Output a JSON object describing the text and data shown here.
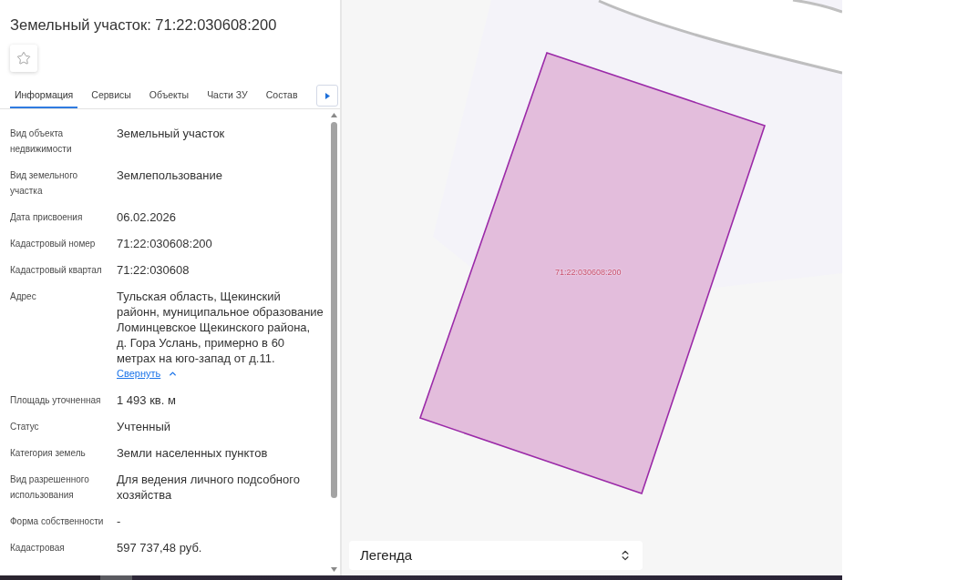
{
  "header": {
    "title": "Земельный участок: 71:22:030608:200"
  },
  "favorite": {
    "active": false
  },
  "tabs": [
    {
      "label": "Информация",
      "selected": true
    },
    {
      "label": "Сервисы",
      "selected": false
    },
    {
      "label": "Объекты",
      "selected": false
    },
    {
      "label": "Части ЗУ",
      "selected": false
    },
    {
      "label": "Состав",
      "selected": false
    }
  ],
  "fields": [
    {
      "kind": "text",
      "label": "Вид объекта недвижимости",
      "value": "Земельный участок"
    },
    {
      "kind": "text",
      "label": "Вид земельного участка",
      "value": "Землепользование"
    },
    {
      "kind": "text",
      "label": "Дата присвоения",
      "value": "06.02.2026"
    },
    {
      "kind": "text",
      "label": "Кадастровый номер",
      "value": "71:22:030608:200"
    },
    {
      "kind": "text",
      "label": "Кадастровый квартал",
      "value": "71:22:030608"
    },
    {
      "kind": "lines",
      "label": "Адрес",
      "value_lines": [
        "Тульская область, Щекинский",
        "районн, муниципальное образование",
        "Ломинцевское Щекинского района,",
        "д. Гора Услань, примерно в 60",
        "метрах на юго-запад от д.11."
      ],
      "toggle": {
        "label": "Свернуть",
        "expanded": true
      }
    },
    {
      "kind": "text",
      "label": "Площадь уточненная",
      "value": "1 493 кв. м"
    },
    {
      "kind": "text",
      "label": "Статус",
      "value": "Учтенный"
    },
    {
      "kind": "text",
      "label": "Категория земель",
      "value": "Земли населенных пунктов"
    },
    {
      "kind": "text",
      "label": "Вид разрешенного использования",
      "value": "Для ведения личного подсобного хозяйства"
    },
    {
      "kind": "text",
      "label": "Форма собственности",
      "value": "-"
    },
    {
      "kind": "text",
      "label": "Кадастровая",
      "value": "597 737,48 руб."
    }
  ],
  "map": {
    "parcel_label": "71:22:030608:200",
    "legend": {
      "label": "Легенда"
    }
  }
}
